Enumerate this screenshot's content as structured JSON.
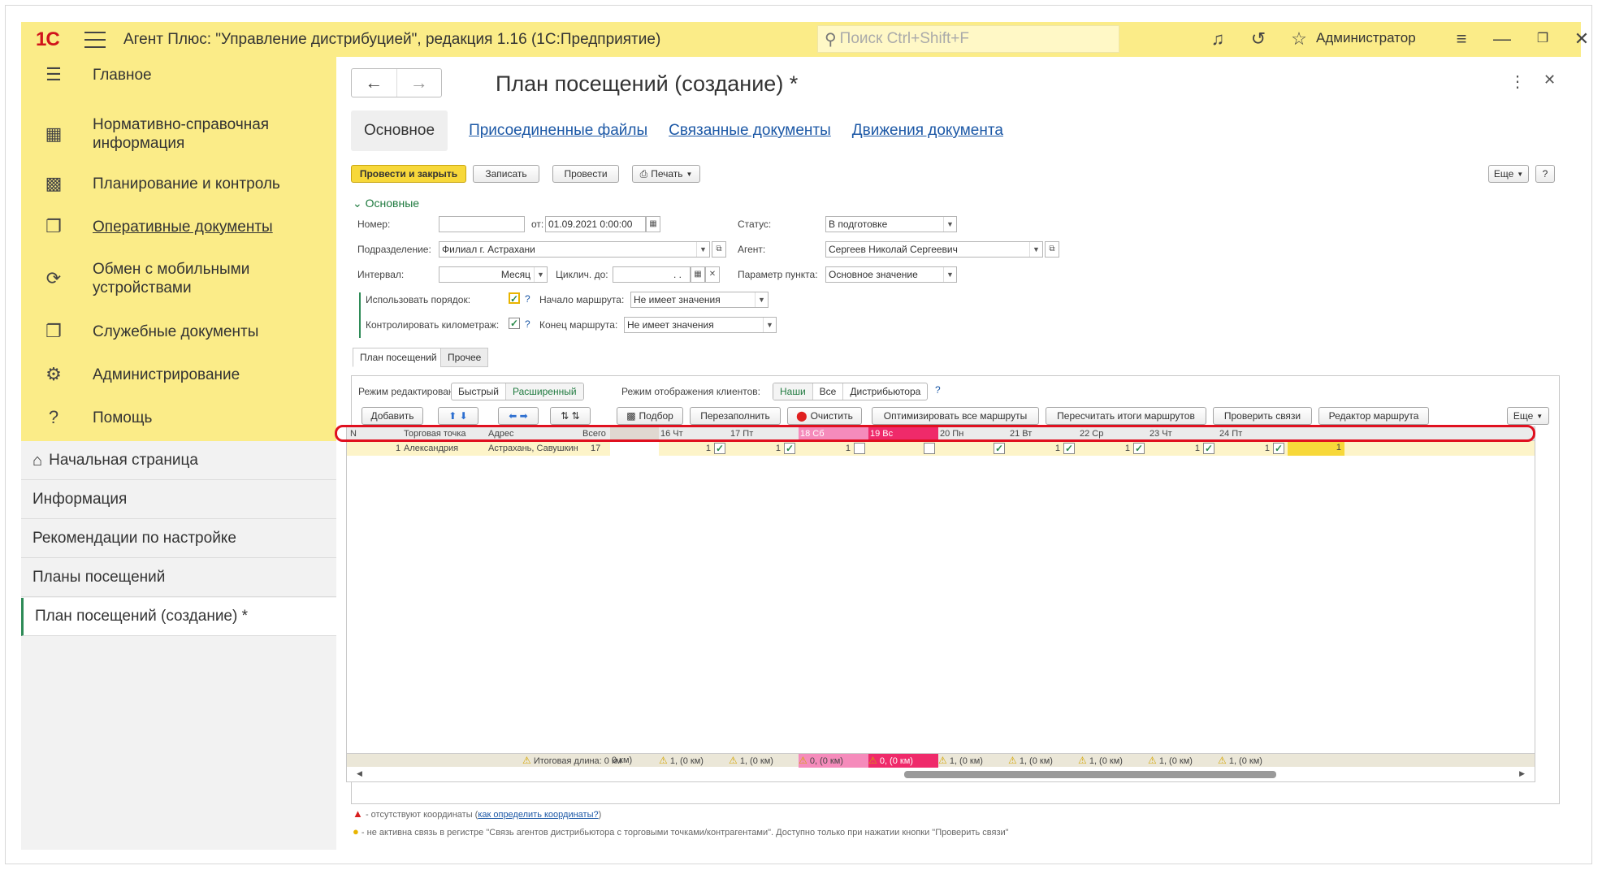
{
  "app": {
    "title": "Агент Плюс: \"Управление дистрибуцией\", редакция 1.16  (1С:Предприятие)",
    "search_placeholder": "Поиск Ctrl+Shift+F",
    "user": "Администратор",
    "accent": "#fbec88"
  },
  "sidebar": {
    "items": [
      {
        "label": "Главное",
        "icon": "menu-icon"
      },
      {
        "label": "Нормативно-справочная информация",
        "icon": "grid-icon"
      },
      {
        "label": "Планирование и контроль",
        "icon": "chart-icon"
      },
      {
        "label": "Оперативные документы",
        "icon": "documents-icon"
      },
      {
        "label": "Обмен с мобильными устройствами",
        "icon": "sync-icon"
      },
      {
        "label": "Служебные документы",
        "icon": "service-docs-icon"
      },
      {
        "label": "Администрирование",
        "icon": "gear-icon"
      },
      {
        "label": "Помощь",
        "icon": "help-icon"
      }
    ],
    "history": [
      "Начальная страница",
      "Информация",
      "Рекомендации по настройке",
      "Планы посещений",
      "План посещений  (создание) *"
    ]
  },
  "form": {
    "title": "План посещений  (создание) *",
    "tabs": [
      "Основное",
      "Присоединенные файлы",
      "Связанные документы",
      "Движения документа"
    ],
    "toolbar": {
      "post_close": "Провести и закрыть",
      "write": "Записать",
      "post": "Провести",
      "print": "Печать",
      "more": "Еще",
      "help": "?"
    },
    "group": "Основные",
    "fields": {
      "number_label": "Номер:",
      "number_value": "",
      "from_label": "от:",
      "from_value": "01.09.2021  0:00:00",
      "status_label": "Статус:",
      "status_value": "В подготовке",
      "division_label": "Подразделение:",
      "division_value": "Филиал г. Астрахани",
      "agent_label": "Агент:",
      "agent_value": "Сергеев Николай Сергеевич",
      "interval_label": "Интервал:",
      "interval_value": "Месяц",
      "cyclic_label": "Циклич. до:",
      "cyclic_value": ". .",
      "point_param_label": "Параметр пункта:",
      "point_param_value": "Основное значение",
      "use_order_label": "Использовать порядок:",
      "route_start_label": "Начало маршрута:",
      "route_start_value": "Не имеет значения",
      "control_km_label": "Контролировать километраж:",
      "route_end_label": "Конец маршрута:",
      "route_end_value": "Не имеет значения"
    },
    "panel_tabs": [
      "План посещений",
      "Прочее"
    ],
    "edit_mode_label": "Режим редактирования:",
    "edit_modes": [
      "Быстрый",
      "Расширенный"
    ],
    "client_mode_label": "Режим отображения клиентов:",
    "client_modes": [
      "Наши",
      "Все",
      "Дистрибьютора"
    ],
    "grid_buttons": {
      "add": "Добавить",
      "pick": "Подбор",
      "refill": "Перезаполнить",
      "clear": "Очистить",
      "optimize": "Оптимизировать все маршруты",
      "recalc": "Пересчитать итоги маршрутов",
      "check": "Проверить связи",
      "editor": "Редактор маршрута",
      "more": "Еще"
    },
    "grid": {
      "columns": [
        "N",
        "Торговая точка",
        "Адрес",
        "Всего"
      ],
      "days": [
        "16 Чт",
        "17 Пт",
        "18 Сб",
        "19 Вс",
        "20 Пн",
        "21 Вт",
        "22 Ср",
        "23 Чт",
        "24 Пт"
      ],
      "row": {
        "n": "1",
        "point": "Александрия",
        "address": "Астрахань, Савушкина ...",
        "total": "17",
        "day_values": [
          "1",
          "1",
          "1",
          "",
          "",
          "1",
          "1",
          "1",
          "1"
        ],
        "last": "1"
      },
      "footer": {
        "total_length": "Итоговая длина: 0 км",
        "partial": "0 км)",
        "day_totals": [
          "1, (0 км)",
          "1, (0 км)",
          "0, (0 км)",
          "0, (0 км)",
          "1, (0 км)",
          "1, (0 км)",
          "1, (0 км)",
          "1, (0 км)",
          "1, (0 км)"
        ]
      }
    },
    "notes": {
      "no_coords": "- отсутствуют координаты (",
      "no_coords_link": "как определить координаты?",
      "no_coords_end": ")",
      "inactive": "- не активна связь в регистре \"Связь агентов дистрибьютора с торговыми точками/контрагентами\". Доступно только при нажатии кнопки \"Проверить связи\""
    }
  }
}
